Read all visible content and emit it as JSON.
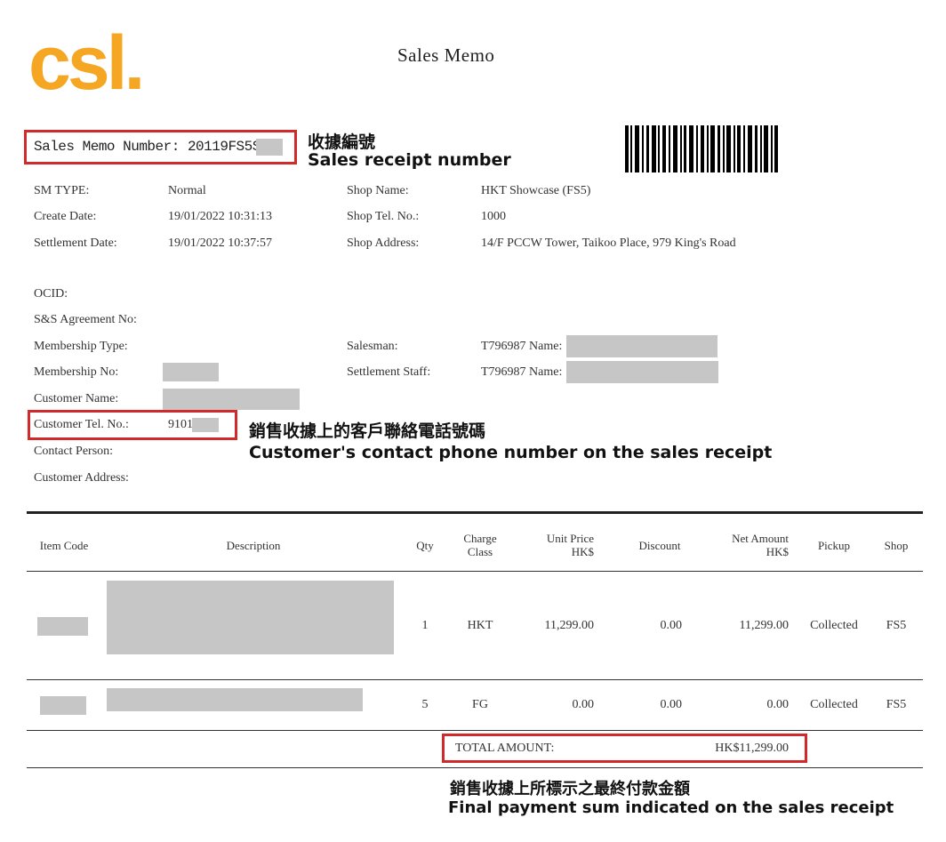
{
  "header": {
    "logo_text": "csl.",
    "title": "Sales Memo",
    "memo_number_label": "Sales Memo Number:",
    "memo_number_value": "20119FS5SB"
  },
  "annotations": {
    "receipt_no_zh": "收據編號",
    "receipt_no_en": "Sales receipt number",
    "phone_zh": "銷售收據上的客戶聯絡電話號碼",
    "phone_en": "Customer's contact phone number on the sales receipt",
    "total_zh": "銷售收據上所標示之最終付款金額",
    "total_en": "Final payment sum indicated on the sales receipt"
  },
  "info": {
    "sm_type_label": "SM TYPE:",
    "sm_type_value": "Normal",
    "create_date_label": "Create Date:",
    "create_date_value": "19/01/2022 10:31:13",
    "settlement_date_label": "Settlement Date:",
    "settlement_date_value": "19/01/2022 10:37:57",
    "shop_name_label": "Shop Name:",
    "shop_name_value": "HKT Showcase (FS5)",
    "shop_tel_label": "Shop Tel. No.:",
    "shop_tel_value": "1000",
    "shop_address_label": "Shop Address:",
    "shop_address_value": "14/F PCCW Tower, Taikoo Place, 979 King's Road",
    "ocid_label": "OCID:",
    "ss_agreement_label": "S&S Agreement No:",
    "membership_type_label": "Membership Type:",
    "membership_no_label": "Membership No:",
    "customer_name_label": "Customer Name:",
    "customer_tel_label": "Customer Tel. No.:",
    "customer_tel_value": "9101",
    "contact_person_label": "Contact Person:",
    "customer_address_label": "Customer Address:",
    "salesman_label": "Salesman:",
    "salesman_value": "T796987 Name:",
    "settlement_staff_label": "Settlement Staff:",
    "settlement_staff_value": "T796987 Name:"
  },
  "table": {
    "headers": {
      "item_code": "Item Code",
      "description": "Description",
      "qty": "Qty",
      "charge_class_1": "Charge",
      "charge_class_2": "Class",
      "unit_price_1": "Unit Price",
      "unit_price_2": "HK$",
      "discount": "Discount",
      "net_amount_1": "Net Amount",
      "net_amount_2": "HK$",
      "pickup": "Pickup",
      "shop": "Shop"
    },
    "rows": [
      {
        "qty": "1",
        "charge_class": "HKT",
        "unit_price": "11,299.00",
        "discount": "0.00",
        "net_amount": "11,299.00",
        "pickup": "Collected",
        "shop": "FS5"
      },
      {
        "qty": "5",
        "charge_class": "FG",
        "unit_price": "0.00",
        "discount": "0.00",
        "net_amount": "0.00",
        "pickup": "Collected",
        "shop": "FS5"
      }
    ],
    "total_label": "TOTAL AMOUNT:",
    "total_value": "HK$11,299.00"
  },
  "colors": {
    "logo": "#F5A623",
    "highlight_box": "#d12a2a",
    "redaction": "#c6c6c6"
  }
}
